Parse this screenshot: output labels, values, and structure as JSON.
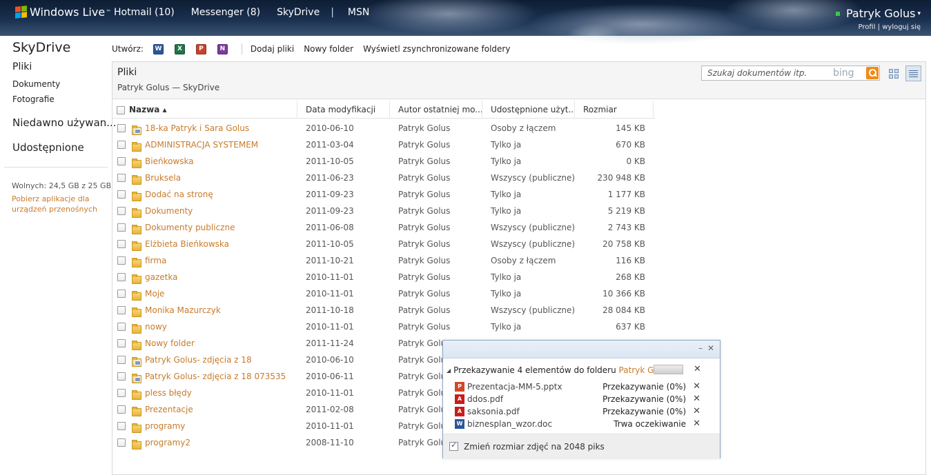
{
  "header": {
    "brand": "Windows Live",
    "brand_mark": "™",
    "nav": [
      "Hotmail (10)",
      "Messenger (8)",
      "SkyDrive",
      "|",
      "MSN"
    ],
    "user_name": "Patryk Golus",
    "user_caret": "▾",
    "profile_link": "Profil",
    "links_sep": " | ",
    "logout_link": "wyloguj się"
  },
  "sidebar": {
    "title": "SkyDrive",
    "items": [
      "Pliki",
      "Dokumenty",
      "Fotografie",
      "Niedawno używan...",
      "Udostępnione"
    ],
    "storage": "Wolnych: 24,5 GB z 25 GB",
    "mobile_link": "Pobierz aplikacje dla urządzeń przenośnych"
  },
  "toolbar": {
    "create_label": "Utwórz:",
    "doc_icons": [
      {
        "name": "word-icon",
        "glyph": "W",
        "color": "#2b579a"
      },
      {
        "name": "excel-icon",
        "glyph": "X",
        "color": "#217346"
      },
      {
        "name": "powerpoint-icon",
        "glyph": "P",
        "color": "#c4442f"
      },
      {
        "name": "onenote-icon",
        "glyph": "N",
        "color": "#7b3b9c"
      }
    ],
    "add_files": "Dodaj pliki",
    "new_folder": "Nowy folder",
    "show_synced": "Wyświetl zsynchronizowane foldery"
  },
  "panel": {
    "title": "Pliki",
    "breadcrumb": "Patryk Golus — SkyDrive",
    "search_placeholder": "Szukaj dokumentów itp.",
    "search_brand": "bing"
  },
  "table": {
    "headers": [
      "Nazwa ▴",
      "Data modyfikacji",
      "Autor ostatniej mo...",
      "Udostępnione użyt...",
      "Rozmiar"
    ],
    "rows": [
      {
        "name": "18-ka Patryk i Sara Golus",
        "date": "2010-06-10",
        "author": "Patryk Golus",
        "shared": "Osoby z łączem",
        "size": "145 KB",
        "type": "photos"
      },
      {
        "name": "ADMINISTRACJA SYSTEMEM",
        "date": "2011-03-04",
        "author": "Patryk Golus",
        "shared": "Tylko ja",
        "size": "670 KB",
        "type": "folder"
      },
      {
        "name": "Bieńkowska",
        "date": "2011-10-05",
        "author": "Patryk Golus",
        "shared": "Tylko ja",
        "size": "0 KB",
        "type": "folder"
      },
      {
        "name": "Bruksela",
        "date": "2011-06-23",
        "author": "Patryk Golus",
        "shared": "Wszyscy (publiczne)",
        "size": "230 948 KB",
        "type": "folder"
      },
      {
        "name": "Dodać na stronę",
        "date": "2011-09-23",
        "author": "Patryk Golus",
        "shared": "Tylko ja",
        "size": "1 177 KB",
        "type": "folder"
      },
      {
        "name": "Dokumenty",
        "date": "2011-09-23",
        "author": "Patryk Golus",
        "shared": "Tylko ja",
        "size": "5 219 KB",
        "type": "folder"
      },
      {
        "name": "Dokumenty publiczne",
        "date": "2011-06-08",
        "author": "Patryk Golus",
        "shared": "Wszyscy (publiczne)",
        "size": "2 743 KB",
        "type": "folder"
      },
      {
        "name": "Elżbieta Bieńkowska",
        "date": "2011-10-05",
        "author": "Patryk Golus",
        "shared": "Wszyscy (publiczne)",
        "size": "20 758 KB",
        "type": "folder"
      },
      {
        "name": "firma",
        "date": "2011-10-21",
        "author": "Patryk Golus",
        "shared": "Osoby z łączem",
        "size": "116 KB",
        "type": "folder"
      },
      {
        "name": "gazetka",
        "date": "2010-11-01",
        "author": "Patryk Golus",
        "shared": "Tylko ja",
        "size": "268 KB",
        "type": "folder"
      },
      {
        "name": "Moje",
        "date": "2010-11-01",
        "author": "Patryk Golus",
        "shared": "Tylko ja",
        "size": "10 366 KB",
        "type": "folder"
      },
      {
        "name": "Monika Mazurczyk",
        "date": "2011-10-18",
        "author": "Patryk Golus",
        "shared": "Wszyscy (publiczne)",
        "size": "28 084 KB",
        "type": "folder"
      },
      {
        "name": "nowy",
        "date": "2010-11-01",
        "author": "Patryk Golus",
        "shared": "Tylko ja",
        "size": "637 KB",
        "type": "folder"
      },
      {
        "name": "Nowy folder",
        "date": "2011-11-24",
        "author": "Patryk Golus",
        "shared": "",
        "size": "",
        "type": "folder"
      },
      {
        "name": "Patryk Golus- zdjęcia z 18",
        "date": "2010-06-10",
        "author": "Patryk Golus",
        "shared": "",
        "size": "",
        "type": "photos"
      },
      {
        "name": "Patryk Golus- zdjęcia z 18 073535",
        "date": "2010-06-11",
        "author": "Patryk Golus",
        "shared": "",
        "size": "",
        "type": "photos"
      },
      {
        "name": "pless błędy",
        "date": "2010-11-01",
        "author": "Patryk Golus",
        "shared": "",
        "size": "",
        "type": "folder"
      },
      {
        "name": "Prezentacje",
        "date": "2011-02-08",
        "author": "Patryk Golus",
        "shared": "",
        "size": "",
        "type": "folder"
      },
      {
        "name": "programy",
        "date": "2010-11-01",
        "author": "Patryk Golus",
        "shared": "",
        "size": "",
        "type": "folder"
      },
      {
        "name": "programy2",
        "date": "2008-11-10",
        "author": "Patryk Golus",
        "shared": "",
        "size": "",
        "type": "folder"
      }
    ]
  },
  "upload": {
    "minimize": "–",
    "close": "✕",
    "collapse_glyph": "◢",
    "group_label": "Przekazywanie 4 elementów do folderu ",
    "group_folder": "Patryk Gol...",
    "items": [
      {
        "name": "Prezentacja-MM-5.pptx",
        "status": "Przekazywanie (0%)",
        "icon": "P",
        "color": "#d24726"
      },
      {
        "name": "ddos.pdf",
        "status": "Przekazywanie (0%)",
        "icon": "A",
        "color": "#c81d1d"
      },
      {
        "name": "saksonia.pdf",
        "status": "Przekazywanie (0%)",
        "icon": "A",
        "color": "#c81d1d"
      },
      {
        "name": "biznesplan_wzor.doc",
        "status": "Trwa oczekiwanie",
        "icon": "W",
        "color": "#2b579a"
      }
    ],
    "resize_label": "Zmień rozmiar zdjęć na 2048 piks",
    "resize_checked": true
  }
}
